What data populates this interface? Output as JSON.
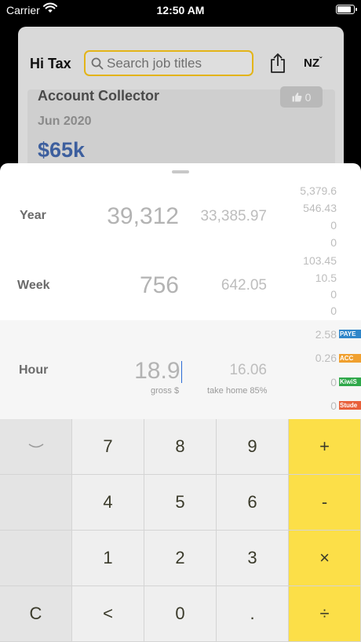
{
  "status": {
    "carrier": "Carrier",
    "time": "12:50 AM",
    "battery_level": 0.9
  },
  "header": {
    "title": "Hi Tax",
    "search_placeholder": "Search job titles",
    "region": "NZ",
    "share_icon": "share-icon",
    "search_icon": "search-icon"
  },
  "job": {
    "title": "Account Collector",
    "date": "Jun 2020",
    "salary": "$65k",
    "likes": "0",
    "like_icon": "thumbs-up-icon"
  },
  "rows": [
    {
      "label": "Year",
      "gross": "39,312",
      "net": "33,385.97",
      "deductions": [
        "5,379.6",
        "546.43",
        "0",
        "0"
      ]
    },
    {
      "label": "Week",
      "gross": "756",
      "net": "642.05",
      "deductions": [
        "103.45",
        "10.5",
        "0",
        "0"
      ]
    },
    {
      "label": "Hour",
      "gross": "18.9",
      "net": "16.06",
      "deductions": [
        "2.58",
        "0.26",
        "0",
        "0"
      ]
    }
  ],
  "captions": {
    "gross": "gross $",
    "net": "take home 85%"
  },
  "tags": [
    {
      "label": "PAYE",
      "color": "#2f86c9"
    },
    {
      "label": "ACC",
      "color": "#f0a030"
    },
    {
      "label": "KiwiS",
      "color": "#2fa84a"
    },
    {
      "label": "Stude",
      "color": "#e8603a"
    }
  ],
  "keypad": {
    "collapse_icon": "chevron-down-icon",
    "keys": [
      "7",
      "8",
      "9",
      "+",
      "4",
      "5",
      "6",
      "-",
      "1",
      "2",
      "3",
      "×",
      "C",
      "<",
      "0",
      ".",
      "÷"
    ]
  }
}
